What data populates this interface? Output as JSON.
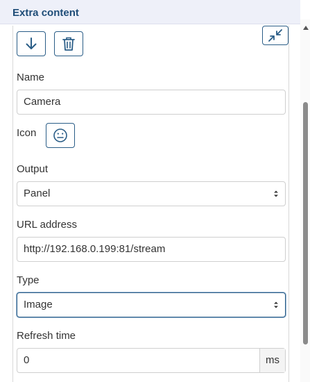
{
  "header": {
    "title": "Extra content"
  },
  "toolbar": {
    "move_down_icon": "arrow-down-icon",
    "delete_icon": "trash-icon",
    "collapse_icon": "collapse-icon"
  },
  "form": {
    "name": {
      "label": "Name",
      "value": "Camera"
    },
    "icon": {
      "label": "Icon",
      "icon": "smiley-face-icon"
    },
    "output": {
      "label": "Output",
      "value": "Panel"
    },
    "url": {
      "label": "URL address",
      "value": "http://192.168.0.199:81/stream"
    },
    "type": {
      "label": "Type",
      "value": "Image"
    },
    "refresh": {
      "label": "Refresh time",
      "value": "0",
      "unit": "ms"
    }
  },
  "colors": {
    "accent": "#2a5d87",
    "header_bg": "#eef0f9",
    "title": "#1f4d78"
  }
}
